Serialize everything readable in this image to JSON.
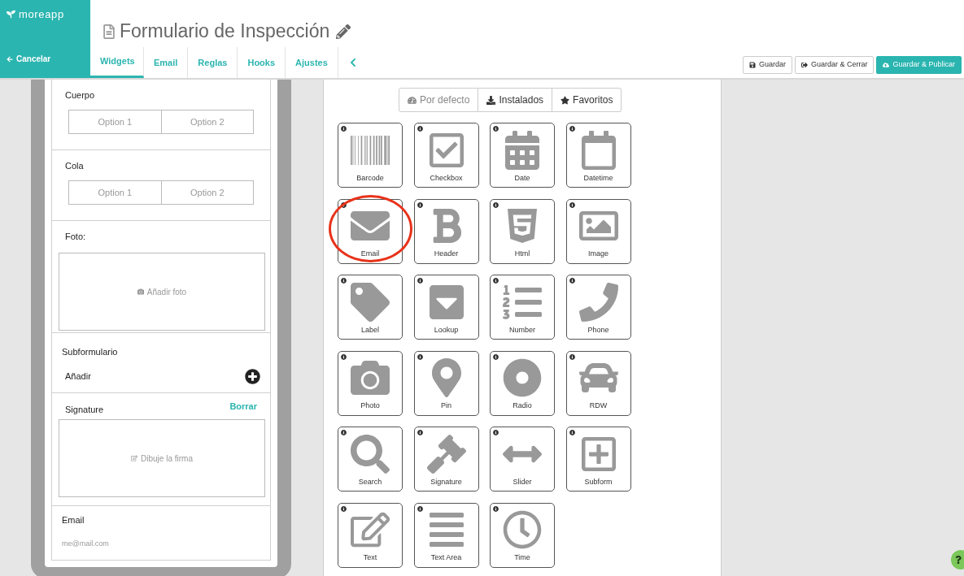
{
  "logo": {
    "text": "moreapp"
  },
  "cancel": {
    "label": "Cancelar"
  },
  "title": "Formulario de Inspección",
  "tabs": [
    {
      "label": "Widgets",
      "selected": true
    },
    {
      "label": "Email",
      "selected": false
    },
    {
      "label": "Reglas",
      "selected": false
    },
    {
      "label": "Hooks",
      "selected": false
    },
    {
      "label": "Ajustes",
      "selected": false
    }
  ],
  "actions": [
    {
      "label": "Guardar",
      "kind": "save"
    },
    {
      "label": "Guardar & Cerrar",
      "kind": "close"
    },
    {
      "label": "Guardar & Publicar",
      "kind": "publish"
    }
  ],
  "form": [
    {
      "kind": "radio",
      "label": "Cuerpo",
      "options": [
        "Option 1",
        "Option 2"
      ]
    },
    {
      "kind": "radio",
      "label": "Cola",
      "options": [
        "Option 1",
        "Option 2"
      ]
    },
    {
      "kind": "photo",
      "label": "Foto:",
      "placeholder": "Añadir foto"
    },
    {
      "kind": "subform",
      "label": "Subformulario",
      "add": "Añadir"
    },
    {
      "kind": "signature",
      "label": "Signature",
      "clear": "Borrar",
      "placeholder": "Dibuje la firma"
    },
    {
      "kind": "email",
      "label": "Email",
      "placeholder": "me@mail.com"
    }
  ],
  "filters": [
    {
      "label": "Por defecto",
      "selected": true
    },
    {
      "label": "Instalados",
      "selected": false
    },
    {
      "label": "Favoritos",
      "selected": false
    }
  ],
  "widgets": [
    {
      "label": "Barcode",
      "highlighted": false
    },
    {
      "label": "Checkbox",
      "highlighted": false
    },
    {
      "label": "Date",
      "highlighted": false
    },
    {
      "label": "Datetime",
      "highlighted": false
    },
    {
      "label": "Email",
      "highlighted": true
    },
    {
      "label": "Header",
      "highlighted": false
    },
    {
      "label": "Html",
      "highlighted": false
    },
    {
      "label": "Image",
      "highlighted": false
    },
    {
      "label": "Label",
      "highlighted": false
    },
    {
      "label": "Lookup",
      "highlighted": false
    },
    {
      "label": "Number",
      "highlighted": false
    },
    {
      "label": "Phone",
      "highlighted": false
    },
    {
      "label": "Photo",
      "highlighted": false
    },
    {
      "label": "Pin",
      "highlighted": false
    },
    {
      "label": "Radio",
      "highlighted": false
    },
    {
      "label": "RDW",
      "highlighted": false
    },
    {
      "label": "Search",
      "highlighted": false
    },
    {
      "label": "Signature",
      "highlighted": false
    },
    {
      "label": "Slider",
      "highlighted": false
    },
    {
      "label": "Subform",
      "highlighted": false
    },
    {
      "label": "Text",
      "highlighted": false
    },
    {
      "label": "Text Area",
      "highlighted": false
    },
    {
      "label": "Time",
      "highlighted": false
    }
  ]
}
